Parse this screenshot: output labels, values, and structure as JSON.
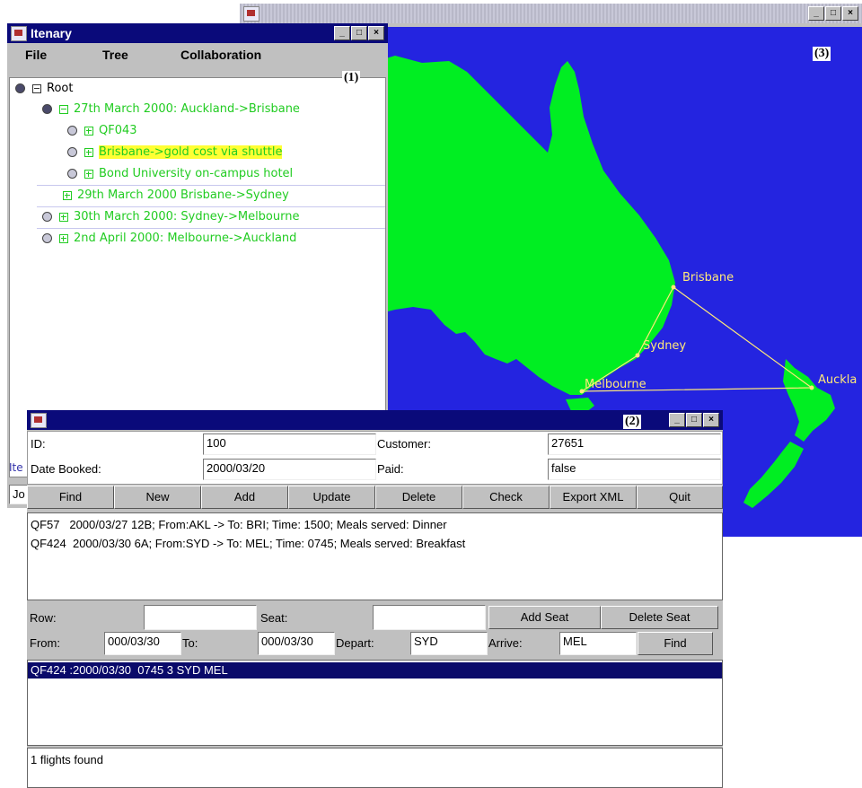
{
  "map_window": {
    "label": "(3)",
    "cities": [
      "Brisbane",
      "Sydney",
      "Melbourne",
      "Auckla"
    ],
    "colors": {
      "sea": "#2424e0",
      "land": "#00ee22",
      "route": "#ffe97a"
    }
  },
  "itinerary_window": {
    "title": "Itenary",
    "label": "(1)",
    "menu": [
      "File",
      "Tree",
      "Collaboration"
    ],
    "tree": {
      "root": "Root",
      "items": [
        {
          "text": "27th March 2000: Auckland->Brisbane"
        },
        {
          "text": "QF043"
        },
        {
          "text": "Brisbane->gold cost via shuttle"
        },
        {
          "text": "Bond University on-campus hotel"
        },
        {
          "text": "29th March 2000 Brisbane->Sydney"
        },
        {
          "text": "30th March 2000: Sydney->Melbourne"
        },
        {
          "text": "2nd April 2000: Melbourne->Auckland"
        }
      ]
    },
    "footer_label": "Ite",
    "footer_field": "Jo"
  },
  "booking_window": {
    "label": "(2)",
    "id_label": "ID:",
    "id_value": "100",
    "customer_label": "Customer:",
    "customer_value": "27651",
    "date_label": "Date Booked:",
    "date_value": "2000/03/20",
    "paid_label": "Paid:",
    "paid_value": "false",
    "buttons": [
      "Find",
      "New",
      "Add",
      "Update",
      "Delete",
      "Check",
      "Export XML",
      "Quit"
    ],
    "bookings": [
      "QF57   2000/03/27 12B; From:AKL -> To: BRI; Time: 1500; Meals served: Dinner",
      "QF424  2000/03/30 6A; From:SYD -> To: MEL; Time: 0745; Meals served: Breakfast"
    ],
    "row_label": "Row:",
    "seat_label": "Seat:",
    "add_seat": "Add Seat",
    "delete_seat": "Delete Seat",
    "from_label": "From:",
    "from_value": "000/03/30",
    "to_label": "To:",
    "to_value": "000/03/30",
    "depart_label": "Depart:",
    "depart_value": "SYD",
    "arrive_label": "Arrive:",
    "arrive_value": "MEL",
    "find2": "Find",
    "result": "QF424 :2000/03/30  0745 3 SYD MEL",
    "status": "1 flights found"
  }
}
